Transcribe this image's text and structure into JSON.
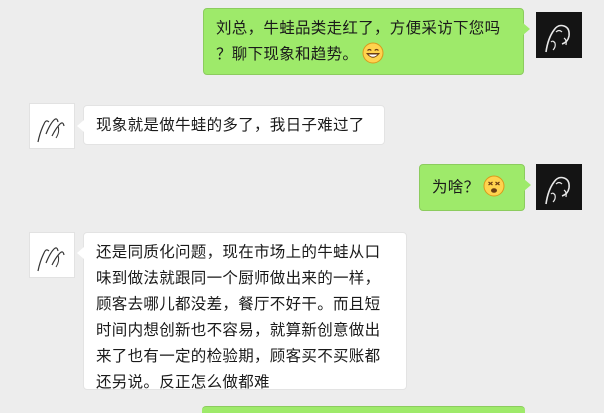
{
  "messages": [
    {
      "sender": "me",
      "lines": [
        "刘总，牛蛙品类走红了，方便采访下您吗",
        "？聊下现象和趋势。"
      ],
      "emoji": "grin-emoji"
    },
    {
      "sender": "them",
      "lines": [
        "现象就是做牛蛙的多了，我日子难过了"
      ]
    },
    {
      "sender": "me",
      "lines": [
        "为啥？"
      ],
      "emoji": "dizzy-face-emoji"
    },
    {
      "sender": "them",
      "lines": [
        "还是同质化问题，现在市场上的牛蛙从口",
        "味到做法就跟同一个厨师做出来的一样，",
        "顾客去哪儿都没差，餐厅不好干。而且短",
        "时间内想创新也不容易，就算新创意做出",
        "来了也有一定的检验期，顾客买不买账都",
        "还另说。反正怎么做都难"
      ]
    }
  ],
  "colors": {
    "background": "#ededed",
    "my_bubble": "#9eea6a",
    "their_bubble": "#ffffff"
  }
}
